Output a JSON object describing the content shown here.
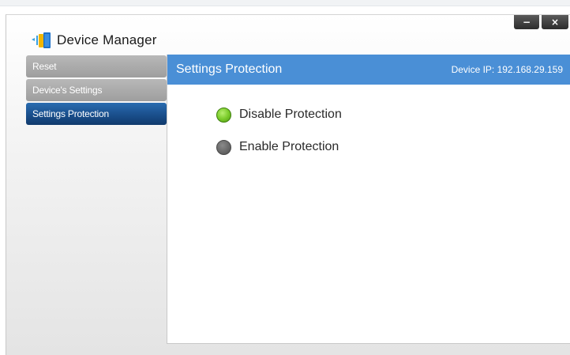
{
  "window": {
    "title": "Device Manager",
    "controls": {
      "minimize_glyph": "−",
      "close_glyph": "×"
    }
  },
  "sidebar": {
    "items": [
      {
        "label": "Reset",
        "active": false
      },
      {
        "label": "Device's Settings",
        "active": false
      },
      {
        "label": "Settings Protection",
        "active": true
      }
    ]
  },
  "main": {
    "title": "Settings Protection",
    "device_ip": "Device IP: 192.168.29.159",
    "options": [
      {
        "label": "Disable Protection",
        "selected": true
      },
      {
        "label": "Enable Protection",
        "selected": false
      }
    ]
  },
  "colors": {
    "header_blue": "#4a8fd6",
    "active_nav": "#1a4f8c",
    "selected_radio": "#7ccc2c",
    "unselected_radio": "#666666"
  },
  "icons": {
    "app": "device-manager-app-icon",
    "minimize": "minimize-icon",
    "close": "close-icon",
    "radio_on": "radio-selected-icon",
    "radio_off": "radio-unselected-icon"
  }
}
